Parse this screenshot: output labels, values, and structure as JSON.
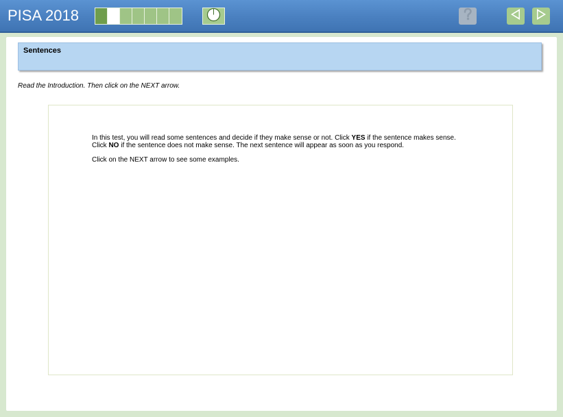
{
  "header": {
    "brand": "PISA 2018",
    "progress": {
      "total_segments": 7,
      "completed_segments": 1,
      "current_segment": 2
    },
    "timer_icon": "clock-icon",
    "help_icon": "question-mark-icon",
    "prev_icon": "arrow-left-icon",
    "next_icon": "arrow-right-icon"
  },
  "unit": {
    "title": "Sentences"
  },
  "instruction": "Read the Introduction. Then click on the NEXT arrow.",
  "stimulus": {
    "para1_part1": "In this test, you will read some sentences and decide if they make sense or not. Click ",
    "para1_yes": "YES",
    "para1_part2": " if the sentence makes sense. Click ",
    "para1_no": "NO",
    "para1_part3": " if the sentence does not make sense. The next sentence will appear as soon as you respond.",
    "para2": "Click on the NEXT arrow to see some examples."
  },
  "colors": {
    "header_blue": "#4a80c0",
    "progress_green": "#9fc486",
    "progress_done": "#6f9d4c",
    "title_panel_blue": "#b7d6f2",
    "background_green": "#d7e8cf"
  }
}
